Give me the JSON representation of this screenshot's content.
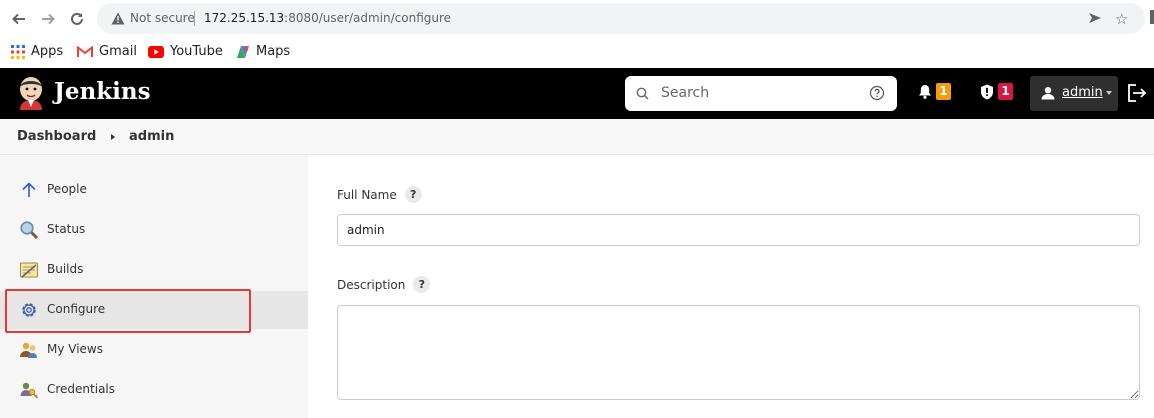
{
  "browser": {
    "security_label": "Not secure",
    "url_host": "172.25.15.13",
    "url_port": ":8080",
    "url_path": "/user/admin/configure",
    "bookmarks": [
      "Apps",
      "Gmail",
      "YouTube",
      "Maps"
    ]
  },
  "header": {
    "title": "Jenkins",
    "search_placeholder": "Search",
    "notifications_count": "1",
    "security_count": "1",
    "user_name": "admin",
    "colors": {
      "bar": "#000000",
      "notify_badge": "#f39c12",
      "security_badge": "#d9163d"
    }
  },
  "breadcrumb": {
    "items": [
      "Dashboard",
      "admin"
    ]
  },
  "sidebar": {
    "items": [
      {
        "label": "People",
        "icon": "arrow-up-icon"
      },
      {
        "label": "Status",
        "icon": "magnifier-icon"
      },
      {
        "label": "Builds",
        "icon": "notepad-icon"
      },
      {
        "label": "Configure",
        "icon": "gear-icon",
        "active": true
      },
      {
        "label": "My Views",
        "icon": "users-icon"
      },
      {
        "label": "Credentials",
        "icon": "credentials-icon"
      }
    ]
  },
  "form": {
    "full_name_label": "Full Name",
    "full_name_value": "admin",
    "description_label": "Description",
    "description_value": "",
    "help_glyph": "?"
  }
}
